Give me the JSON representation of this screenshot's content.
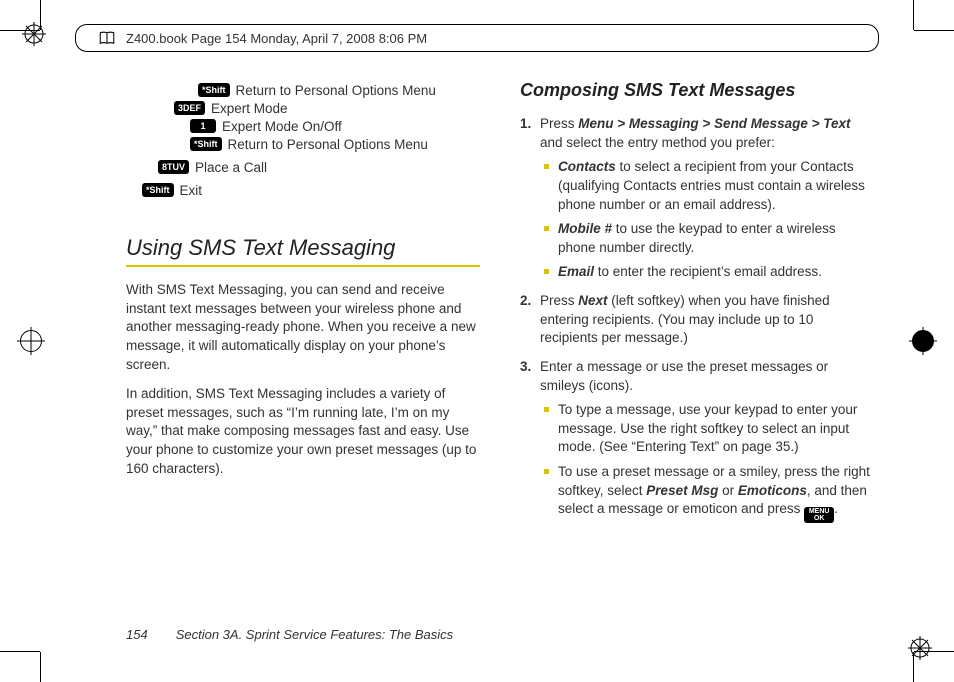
{
  "header": {
    "text": "Z400.book  Page 154  Monday, April 7, 2008  8:06 PM"
  },
  "menu": {
    "row1": {
      "key": "*Shift",
      "label": "Return to Personal Options Menu"
    },
    "row2": {
      "key": "3DEF",
      "label": "Expert Mode"
    },
    "row3": {
      "key": "1",
      "label": "Expert Mode On/Off"
    },
    "row4": {
      "key": "*Shift",
      "label": "Return to Personal Options Menu"
    },
    "row5": {
      "key": "8TUV",
      "label": "Place a Call"
    },
    "row6": {
      "key": "*Shift",
      "label": "Exit"
    }
  },
  "left": {
    "heading": "Using SMS Text Messaging",
    "p1": "With SMS Text Messaging, you can send and receive instant text messages between your wireless phone and another messaging-ready phone. When you receive a new message, it will automatically display on your phone’s screen.",
    "p2": "In addition, SMS Text Messaging includes a variety of preset messages, such as “I’m running late, I’m on my way,” that make composing messages fast and easy. Use your phone to customize your own preset messages (up to 160 characters)."
  },
  "right": {
    "heading": "Composing SMS Text Messages",
    "step1_pre": "Press ",
    "step1_nav": "Menu > Messaging > Send Message > Text",
    "step1_post": " and select the entry method you prefer:",
    "b1_label": "Contacts",
    "b1_text": " to select a recipient from your Contacts (qualifying Contacts entries must contain a wireless phone number or an email address).",
    "b2_label": "Mobile #",
    "b2_text": " to use the keypad to enter a wireless phone number directly.",
    "b3_label": "Email",
    "b3_text": " to enter the recipient’s email address.",
    "step2_pre": "Press ",
    "step2_key": "Next",
    "step2_post": " (left softkey) when you have finished entering recipients. (You may include up to 10 recipients per message.)",
    "step3": "Enter a message or use the preset messages or smileys (icons).",
    "b4": "To type a message, use your keypad to enter your message. Use the right softkey to select an input mode. (See “Entering Text” on page 35.)",
    "b5_pre": "To use a preset message or a smiley, press the right softkey, select ",
    "b5_k1": "Preset Msg",
    "b5_mid": " or ",
    "b5_k2": "Emoticons",
    "b5_post": ", and then select a message or emoticon and press ",
    "b5_end": "."
  },
  "footer": {
    "page": "154",
    "section": "Section 3A. Sprint Service Features: The Basics"
  },
  "keys": {
    "menu_ok": "MENU OK"
  }
}
